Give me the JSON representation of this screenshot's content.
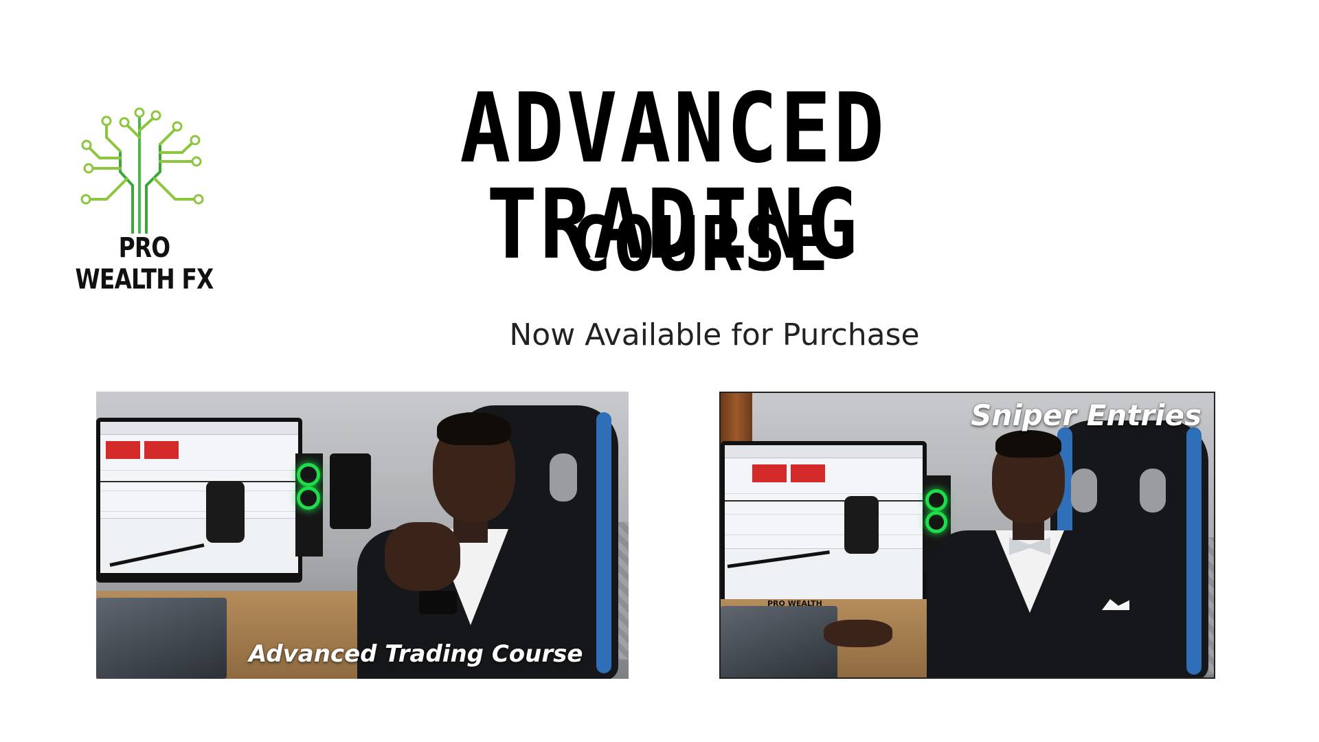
{
  "brand": {
    "logo_text": "PRO WEALTH FX",
    "logo_icon": "circuit-tree-icon",
    "logo_color_light": "#8cc63f",
    "logo_color_dark": "#39a935"
  },
  "headline": {
    "line1": "ADVANCED TRADING",
    "line2": "COURSE"
  },
  "subtitle": "Now Available for Purchase",
  "thumbnails": [
    {
      "overlay_text": "Advanced Trading Course"
    },
    {
      "overlay_text": "Sniper Entries",
      "mini_logo_text": "PRO WEALTH"
    }
  ],
  "colors": {
    "background": "#ffffff",
    "headline": "#000000",
    "chair_accent": "#2f6fb8",
    "pc_glow": "#1fdd4a",
    "chart_sell_button": "#d52a2a"
  }
}
